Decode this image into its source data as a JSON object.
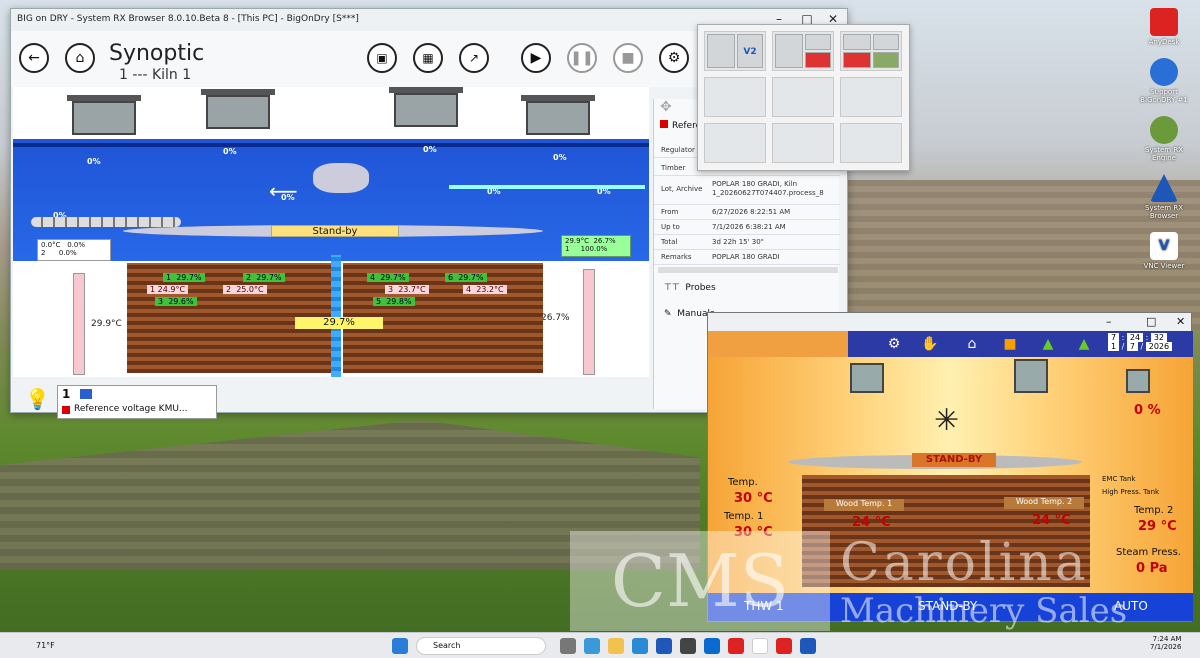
{
  "main_window": {
    "title": "BIG on DRY - System RX Browser 8.0.10.Beta 8 - [This PC] - BigOnDry [S***]",
    "page_title": "Synoptic",
    "page_subtitle": "1 --- Kiln 1"
  },
  "synoptic": {
    "fan_pcts": [
      "0%",
      "0%",
      "0%",
      "0%",
      "0%",
      "0%",
      "0%",
      "0%"
    ],
    "status": "Stand-by",
    "left_readout": {
      "temp": "0.0°C",
      "pct1": "0.0%",
      "num": "2",
      "pct2": "0.0%"
    },
    "right_readout": {
      "temp": "29.9°C",
      "pct1": "26.7%",
      "num": "1",
      "pct2": "100.0%"
    },
    "left_column_temp": "29.9°C",
    "right_column_pct": "26.7%",
    "center_value": "29.7%",
    "probe_labels": [
      {
        "n": "1",
        "v": "29.7%"
      },
      {
        "n": "2",
        "v": "29.7%"
      },
      {
        "n": "1",
        "v": "24.9°C"
      },
      {
        "n": "2",
        "v": "25.0°C"
      },
      {
        "n": "3",
        "v": "29.6%"
      },
      {
        "n": "4",
        "v": "29.7%"
      },
      {
        "n": "6",
        "v": "29.7%"
      },
      {
        "n": "3",
        "v": "23.7°C"
      },
      {
        "n": "4",
        "v": "23.2°C"
      },
      {
        "n": "5",
        "v": "29.8%"
      }
    ],
    "footer": {
      "num": "1",
      "label": "Reference voltage KMU..."
    }
  },
  "info_panel": {
    "header": "Refere",
    "rows": [
      {
        "k": "Regulator",
        "v": ""
      },
      {
        "k": "Timber",
        "v": ""
      },
      {
        "k": "Lot, Archive",
        "v": "POPLAR 180 GRADI, Kiln 1_20260627T074407.process_8"
      },
      {
        "k": "From",
        "v": "6/27/2026 8:22:51 AM"
      },
      {
        "k": "Up to",
        "v": "7/1/2026 6:38:21 AM"
      },
      {
        "k": "Total",
        "v": "3d 22h 15' 30\""
      },
      {
        "k": "Remarks",
        "v": "POPLAR 180 GRADI"
      }
    ],
    "probes_label": "Probes",
    "manuals_label": "Manuals"
  },
  "layout_popup": {
    "vc_label": "V2"
  },
  "second_window": {
    "fan_pct": "0 %",
    "header_row1": [
      "7",
      "24",
      "32"
    ],
    "header_row2": [
      "1",
      "7",
      "2026"
    ],
    "status_sign": "STAND-BY",
    "emc_tank": "EMC Tank",
    "high_press_tank": "High Press. Tank",
    "temp_label": "Temp.",
    "temp_value": "30 °C",
    "temp1_label": "Temp. 1",
    "temp1_value": "30 °C",
    "wood1_label": "Wood Temp. 1",
    "wood1_value": "24 °C",
    "wood2_label": "Wood Temp. 2",
    "wood2_value": "24 °C",
    "temp2_label": "Temp. 2",
    "temp2_value": "29 °C",
    "steam_label": "Steam Press.",
    "steam_value": "0 Pa",
    "status_left": "THW 1",
    "status_center": "STAND-BY",
    "status_right": "AUTO"
  },
  "desktop_icons": [
    {
      "label": "AnyDesk",
      "color": "#d22"
    },
    {
      "label": "Support BIGonDRY #1",
      "color": "#2a6fd6"
    },
    {
      "label": "System RX Engine",
      "color": "#6a9a3a"
    },
    {
      "label": "System RX Browser",
      "color": "#1d57b8"
    },
    {
      "label": "VNC Viewer",
      "color": "#fff"
    }
  ],
  "taskbar": {
    "weather": "71°F",
    "search": "Search",
    "time": "7:24 AM",
    "date": "7/1/2026"
  },
  "watermark": {
    "logo": "CMS",
    "name": "Carolina",
    "sub": "Machinery Sales"
  }
}
